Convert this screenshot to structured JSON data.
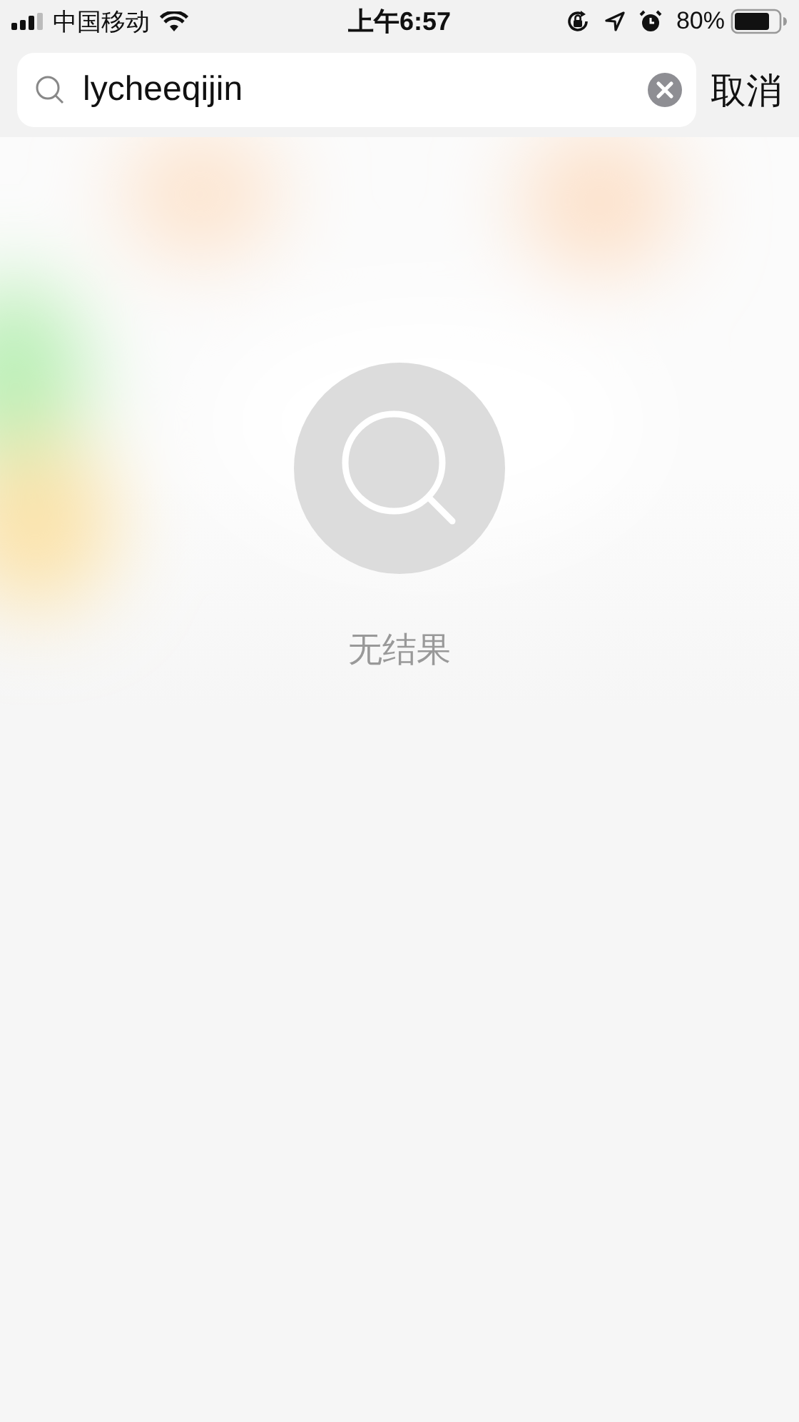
{
  "status_bar": {
    "carrier": "中国移动",
    "time": "上午6:57",
    "battery": "80%"
  },
  "search": {
    "value": "lycheeqijin",
    "cancel": "取消"
  },
  "empty_state": {
    "message": "无结果"
  }
}
